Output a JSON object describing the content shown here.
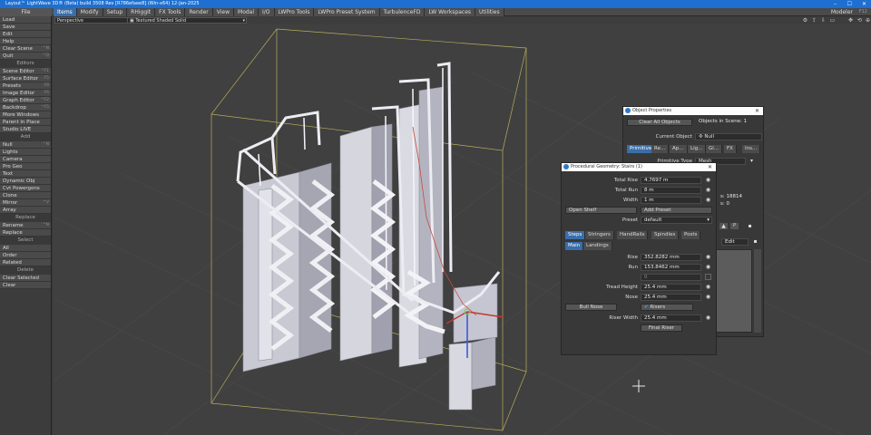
{
  "title": "Layout™ LightWave 3D® (Beta) build 3508 Rev [R786efaee8] (Win-x64) 12-Jan-2025",
  "menu": {
    "file": "File",
    "modeler": "Modeler",
    "modeler_key": "F12",
    "tabs": [
      "Items",
      "Modify",
      "Setup",
      "RHiggit",
      "FX Tools",
      "Render",
      "View",
      "Modal",
      "I/O",
      "LWPro Tools",
      "LWPro Preset System",
      "TurbulenceFD",
      "LW Workspaces",
      "Utilities"
    ],
    "active_tab": "Items"
  },
  "toolbar": {
    "view": "Perspective",
    "shading": "Textured Shaded Solid"
  },
  "sidebar": [
    {
      "label": "Load"
    },
    {
      "label": "Save"
    },
    {
      "label": "Edit"
    },
    {
      "label": "Help"
    },
    {
      "label": "Clear Scene",
      "key": "^N"
    },
    {
      "label": "Quit",
      "key": "^Q"
    },
    {
      "head": "Editors"
    },
    {
      "label": "Scene Editor",
      "key": "^F1"
    },
    {
      "label": "Surface Editor",
      "key": "F5"
    },
    {
      "label": "Presets",
      "key": "F8"
    },
    {
      "label": "Image Editor",
      "key": "F6"
    },
    {
      "label": "Graph Editor",
      "key": "^F2"
    },
    {
      "label": "Backdrop",
      "key": "^F5"
    },
    {
      "label": "More Windows"
    },
    {
      "label": "Parent in Place"
    },
    {
      "label": "Studio LIVE"
    },
    {
      "head": "Add"
    },
    {
      "label": "Null",
      "key": "^N"
    },
    {
      "label": "Lights"
    },
    {
      "label": "Camera"
    },
    {
      "label": "Pro Geo"
    },
    {
      "label": "Text"
    },
    {
      "label": "Dynamic Obj"
    },
    {
      "label": "Cvt Powergons"
    },
    {
      "label": "Clone"
    },
    {
      "label": "Mirror",
      "key": "^V"
    },
    {
      "label": "Array"
    },
    {
      "head": "Replace"
    },
    {
      "label": "Rename",
      "key": "^N"
    },
    {
      "label": "Replace"
    },
    {
      "head": "Select"
    },
    {
      "label": "All"
    },
    {
      "label": "Order"
    },
    {
      "label": "Related"
    },
    {
      "head": "Delete"
    },
    {
      "label": "Clear Selected"
    },
    {
      "label": "Clear"
    }
  ],
  "object_properties": {
    "title": "Object Properties",
    "clear_all": "Clear All Objects",
    "objects_in_scene": "Objects in Scene: 1",
    "current_object_label": "Current Object",
    "current_object": "Null",
    "tabs": [
      "Primitive",
      "Re...",
      "Ap...",
      "Lig...",
      "Gl...",
      "FX",
      "Ins..."
    ],
    "primitive_type_label": "Primitive Type",
    "primitive_type": "Mesh",
    "polys": "s: 18814",
    "points": "s: 0",
    "edit": "Edit"
  },
  "stairs": {
    "title": "Procedural Geometry: Stairs (1)",
    "total_rise_label": "Total Rise",
    "total_rise": "4.7697 m",
    "total_run_label": "Total Run",
    "total_run": "8 m",
    "width_label": "Width",
    "width": "1 m",
    "open_shelf": "Open Shelf",
    "add_preset": "Add Preset",
    "preset_label": "Preset",
    "preset": "default",
    "tabs": [
      "Steps",
      "Stringers",
      "HandRails",
      "Spindles",
      "Posts"
    ],
    "subtabs": [
      "Main",
      "Landings"
    ],
    "rise_label": "Rise",
    "rise": "352.8282 mm",
    "run_label": "Run",
    "run": "153.8462 mm",
    "count_value": "0",
    "tread_height_label": "Tread Height",
    "tread_height": "25.4 mm",
    "nose_label": "Nose",
    "nose": "25.4 mm",
    "bull_nose": "Bull Nose",
    "risers": "Risers",
    "riser_width_label": "Riser Width",
    "riser_width": "25.4 mm",
    "final_riser": "Final Riser"
  }
}
